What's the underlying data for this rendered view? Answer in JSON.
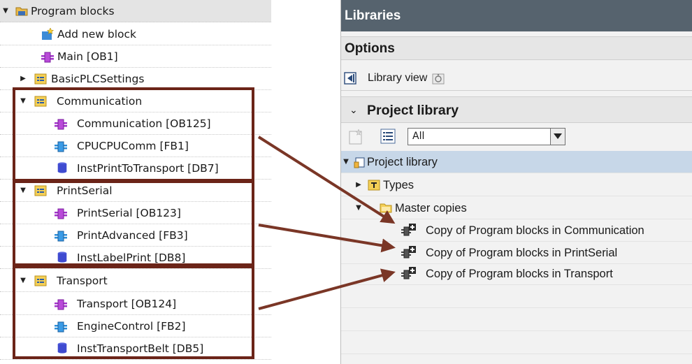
{
  "tree": {
    "items": [
      {
        "label": "Program blocks",
        "icon": "program-blocks-folder-icon",
        "expanded": true
      },
      {
        "label": "Add new block",
        "icon": "add-new-block-icon"
      },
      {
        "label": "Main [OB1]",
        "icon": "organization-block-icon"
      },
      {
        "label": "BasicPLCSettings",
        "icon": "group-folder-icon",
        "expanded": false
      },
      {
        "label": "Communication",
        "icon": "group-folder-icon",
        "expanded": true
      },
      {
        "label": "Communication [OB125]",
        "icon": "organization-block-icon"
      },
      {
        "label": "CPUCPUComm [FB1]",
        "icon": "function-block-icon"
      },
      {
        "label": "InstPrintToTransport [DB7]",
        "icon": "data-block-icon"
      },
      {
        "label": "PrintSerial",
        "icon": "group-folder-icon",
        "expanded": true
      },
      {
        "label": "PrintSerial [OB123]",
        "icon": "organization-block-icon"
      },
      {
        "label": "PrintAdvanced [FB3]",
        "icon": "function-block-icon"
      },
      {
        "label": "InstLabelPrint [DB8]",
        "icon": "data-block-icon"
      },
      {
        "label": "Transport",
        "icon": "group-folder-icon",
        "expanded": true
      },
      {
        "label": "Transport [OB124]",
        "icon": "organization-block-icon"
      },
      {
        "label": "EngineControl [FB2]",
        "icon": "function-block-icon"
      },
      {
        "label": "InstTransportBelt [DB5]",
        "icon": "data-block-icon"
      }
    ]
  },
  "libraries": {
    "title": "Libraries",
    "options_label": "Options",
    "library_view_label": "Library view",
    "project_library_header": "Project library",
    "filter_value": "All",
    "tree": {
      "root": "Project library",
      "types": "Types",
      "master_copies": "Master copies",
      "copies": [
        "Copy of Program blocks in Communication",
        "Copy of Program blocks in PrintSerial",
        "Copy of Program blocks in Transport"
      ]
    }
  },
  "colors": {
    "highlight_box": "#6b2418",
    "arrow": "#7a3626",
    "libraries_titlebar": "#56636e",
    "selected_row": "#c7d7e8"
  }
}
